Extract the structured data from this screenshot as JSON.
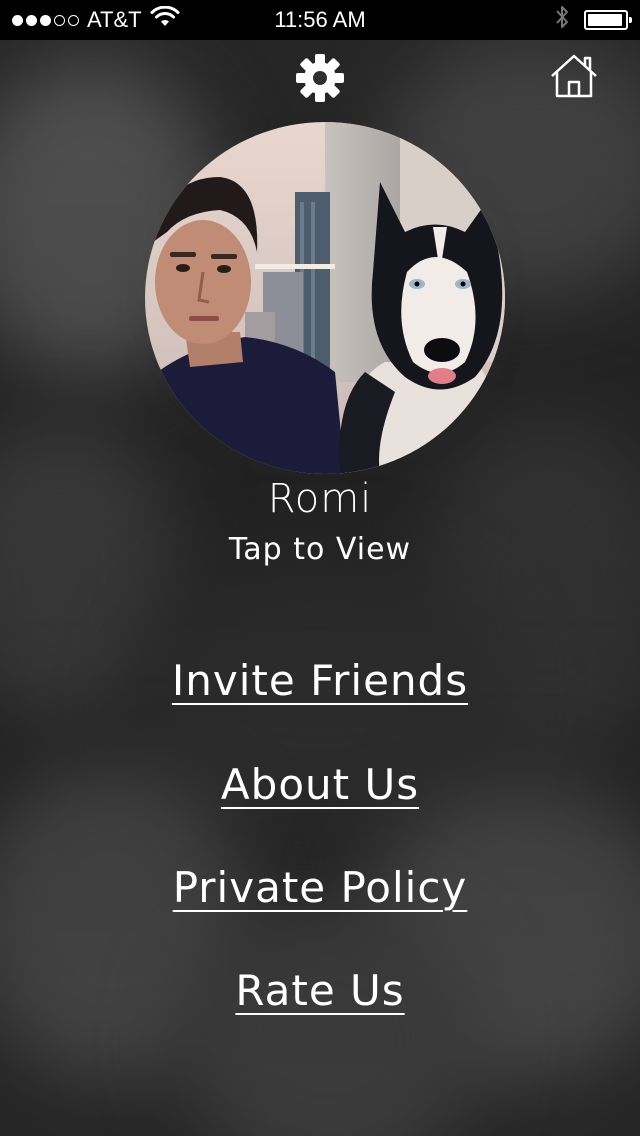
{
  "status_bar": {
    "carrier": "AT&T",
    "time": "11:56 AM",
    "signal_strength": 3,
    "signal_max": 5,
    "battery_level": 0.95,
    "icons": [
      "signal-dots",
      "wifi-icon",
      "bluetooth-icon",
      "battery-icon"
    ]
  },
  "header": {
    "settings_icon": "gear-icon",
    "home_icon": "home-icon"
  },
  "profile": {
    "name": "Romi",
    "hint": "Tap to View"
  },
  "menu": {
    "items": [
      {
        "label": "Invite Friends"
      },
      {
        "label": "About Us"
      },
      {
        "label": "Private Policy"
      },
      {
        "label": "Rate Us"
      }
    ]
  },
  "colors": {
    "text": "#ffffff",
    "status_bar_bg": "#000000",
    "background": "#2b2b2b"
  }
}
